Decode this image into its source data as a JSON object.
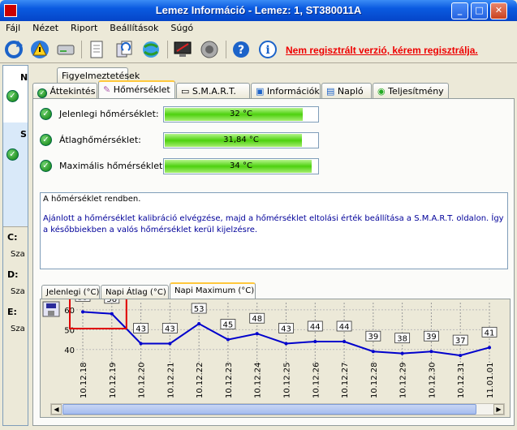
{
  "window": {
    "title": "Lemez Információ - Lemez: 1, ST380011A",
    "btn_min": "_",
    "btn_max": "□",
    "btn_close": "✕"
  },
  "menu": [
    "Fájl",
    "Nézet",
    "Riport",
    "Beállítások",
    "Súgó"
  ],
  "toolbar": {
    "icons": [
      "refresh-icon",
      "warning-icon",
      "drive-icon",
      "document-icon",
      "copy-icon",
      "network-icon",
      "monitor-icon",
      "speaker-icon",
      "help-icon",
      "info-icon"
    ],
    "register_link": "Nem regisztrált verzió, kérem regisztrálja."
  },
  "top_tab": "Figyelmeztetések",
  "tabs": [
    "Áttekintés",
    "Hőmérséklet",
    "S.M.A.R.T.",
    "Információk",
    "Napló",
    "Teljesítmény"
  ],
  "active_tab_index": 1,
  "left_panel": {
    "labels": [
      "N",
      "S"
    ],
    "drives": [
      {
        "letter": "C:",
        "sub": "Sza"
      },
      {
        "letter": "D:",
        "sub": "Sza"
      },
      {
        "letter": "E:",
        "sub": "Sza"
      }
    ]
  },
  "temps": [
    {
      "label": "Jelenlegi hőmérséklet:",
      "value": "32 °C",
      "level": 0.32
    },
    {
      "label": "Átlaghőmérséklet:",
      "value": "31,84 °C",
      "level": 0.3184
    },
    {
      "label": "Maximális hőmérséklet:",
      "value": "34 °C",
      "level": 0.34
    }
  ],
  "message": {
    "line1": "A hőmérséklet rendben.",
    "line2": "Ajánlott a hőmérséklet kalibráció elvégzése, majd a hőmérséklet eltolási érték beállítása a S.M.A.R.T. oldalon. Így a későbbiekben a valós hőmérséklet kerül kijelzésre."
  },
  "chart_tabs": [
    "Jelenlegi (°C)",
    "Napi Átlag (°C)",
    "Napi Maximum (°C)"
  ],
  "chart_active_tab": 2,
  "chart_data": {
    "type": "line",
    "x": [
      "10.12.18",
      "10.12.19",
      "10.12.20",
      "10.12.21",
      "10.12.22",
      "10.12.23",
      "10.12.24",
      "10.12.25",
      "10.12.26",
      "10.12.27",
      "10.12.28",
      "10.12.29",
      "10.12.30",
      "10.12.31",
      "11.01.01"
    ],
    "series": [
      {
        "values": [
          59,
          58,
          43,
          43,
          53,
          45,
          48,
          43,
          44,
          44,
          39,
          38,
          39,
          37,
          41
        ]
      }
    ],
    "ylabel": "",
    "yticks": [
      "60",
      "50",
      "40"
    ],
    "ylim": [
      35,
      62
    ],
    "grid": true,
    "highlight_range": [
      0,
      1
    ]
  },
  "colors": {
    "line": "#0000cc",
    "message_blue": "#000099",
    "warn": "#ee0000",
    "highlight": "#e00000"
  }
}
